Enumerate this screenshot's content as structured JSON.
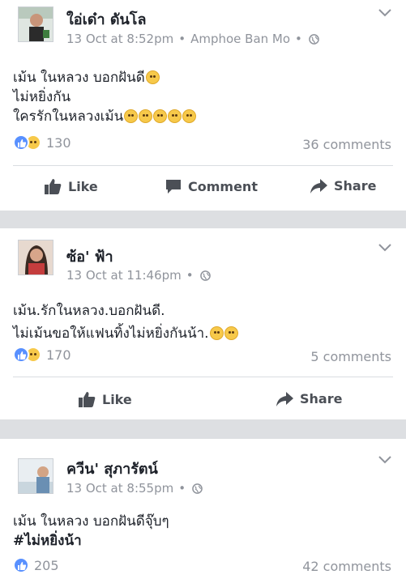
{
  "posts": [
    {
      "author": "ใอ่เด๋า ดันโล",
      "timestamp": "13 Oct at 8:52pm",
      "location": "Amphoe Ban Mo",
      "lines": [
        "เม้น ในหลวง บอกฝันดี",
        "ไม่หยิ่งกัน",
        "ใครรักในหลวงเม้น"
      ],
      "reaction_count": "130",
      "comments": "36 comments",
      "actions": {
        "like": "Like",
        "comment": "Comment",
        "share": "Share"
      }
    },
    {
      "author": "ซ้อ' ฟ้า",
      "timestamp": "13 Oct at 11:46pm",
      "lines": [
        "เม้น.รักในหลวง.บอกฝันดี.",
        "ไม่เม้นขอให้แฟนทิ้งไม่หยิ่งกันน้า."
      ],
      "reaction_count": "170",
      "comments": "5 comments",
      "actions": {
        "like": "Like",
        "share": "Share"
      }
    },
    {
      "author": "ควีน' สุภารัตน์",
      "timestamp": "13 Oct at 8:55pm",
      "lines": [
        "เม้น ในหลวง บอกฝันดีจุ๊บๆ",
        "#ไม่หยิ่งน้า"
      ],
      "reaction_count": "205",
      "comments": "42 comments"
    }
  ],
  "icons": {
    "reaction_like": "like-reaction-icon",
    "reaction_sad": "sad-reaction-icon",
    "privacy": "globe-icon",
    "menu": "chevron-down-icon"
  },
  "colors": {
    "background": "#dddfe2",
    "meta_gray": "#90949c",
    "like_blue": "#5890ff",
    "action_gray": "#4b4f56"
  }
}
